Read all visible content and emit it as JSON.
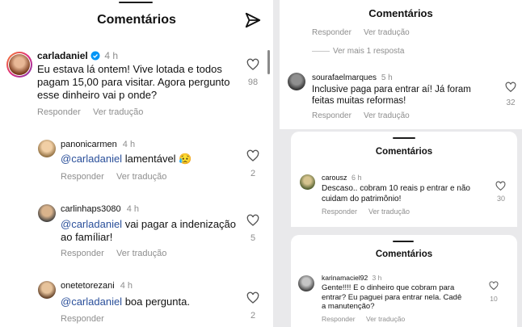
{
  "left": {
    "title": "Comentários",
    "main_comment": {
      "username": "carladaniel",
      "time": "4 h",
      "text": "Eu estava lá ontem! Vive lotada e todos pagam 15,00 para visitar. Agora pergunto esse dinheiro vai p onde?",
      "reply": "Responder",
      "translate": "Ver tradução",
      "likes": "98"
    },
    "replies": [
      {
        "username": "panonicarmen",
        "time": "4 h",
        "mention": "@carladaniel",
        "text": "lamentável 😥",
        "reply": "Responder",
        "translate": "Ver tradução",
        "likes": "2"
      },
      {
        "username": "carlinhaps3080",
        "time": "4 h",
        "mention": "@carladaniel",
        "text": "vai pagar a indenização ao famíliar!",
        "reply": "Responder",
        "translate": "Ver tradução",
        "likes": "5"
      },
      {
        "username": "onetetorezani",
        "time": "4 h",
        "mention": "@carladaniel",
        "text": "boa pergunta.",
        "reply": "Responder",
        "likes": "2"
      }
    ]
  },
  "right_top": {
    "title": "Comentários",
    "reply": "Responder",
    "translate": "Ver tradução",
    "more": "Ver mais 1 resposta",
    "comment": {
      "username": "sourafaelmarques",
      "time": "5 h",
      "text": "Inclusive paga para entrar aí! Já foram feitas muitas reformas!",
      "reply": "Responder",
      "translate": "Ver tradução",
      "likes": "32"
    }
  },
  "right_mid": {
    "title": "Comentários",
    "comment": {
      "username": "carousz",
      "time": "6 h",
      "text": "Descaso.. cobram 10 reais p entrar e não cuidam do patrimônio!",
      "reply": "Responder",
      "translate": "Ver tradução",
      "likes": "30"
    }
  },
  "right_bot": {
    "title": "Comentários",
    "comment": {
      "username": "karinamaciel92",
      "time": "3 h",
      "text": "Gente!!!! E o dinheiro que cobram para entrar? Eu paguei para entrar nela. Cadê a manutenção?",
      "reply": "Responder",
      "translate": "Ver tradução",
      "likes": "10"
    }
  },
  "colors": {
    "verified": "#0095f6",
    "mention": "#2a4f9a",
    "muted": "#8e8e8e"
  },
  "icons": [
    "send-icon",
    "heart-icon",
    "verified-icon"
  ]
}
